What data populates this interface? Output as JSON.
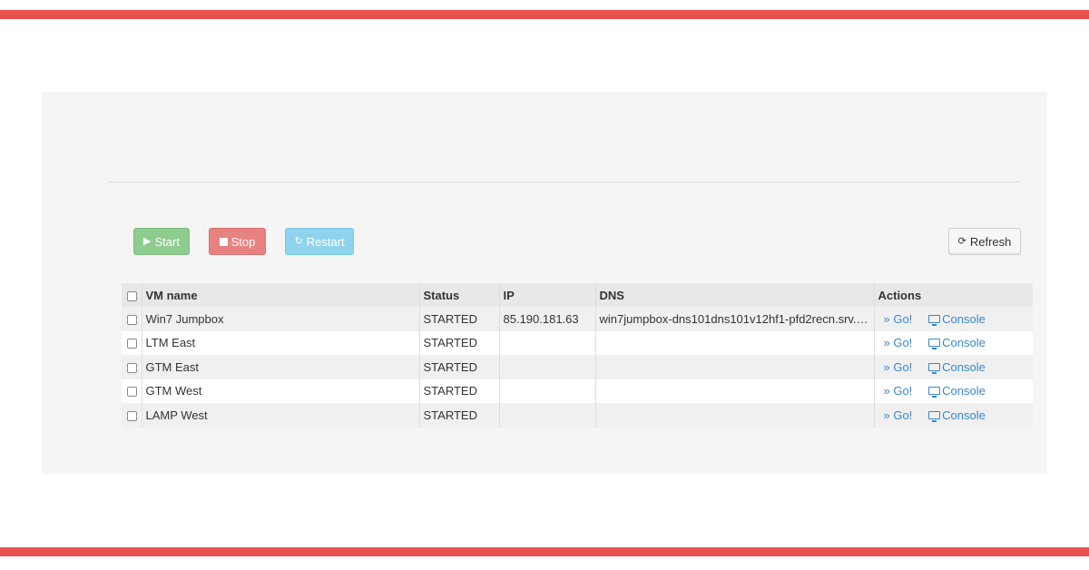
{
  "colors": {
    "stripe": "#e8514e",
    "start": "#8fcc8f",
    "stop": "#e68380",
    "restart": "#8fd3ee",
    "link": "#3a87c8"
  },
  "toolbar": {
    "start_label": "Start",
    "start_icon": "play-icon",
    "stop_label": "Stop",
    "stop_icon": "stop-icon",
    "restart_label": "Restart",
    "restart_icon": "restart-icon",
    "refresh_label": "Refresh",
    "refresh_icon": "refresh-icon"
  },
  "table": {
    "headers": {
      "name": "VM name",
      "status": "Status",
      "ip": "IP",
      "dns": "DNS",
      "actions": "Actions"
    },
    "rows": [
      {
        "name": "Win7 Jumpbox",
        "status": "STARTED",
        "ip": "85.190.181.63",
        "dns": "win7jumpbox-dns101dns101v12hf1-pfd2recn.srv.ra…",
        "go": "» Go!",
        "console": "Console"
      },
      {
        "name": "LTM East",
        "status": "STARTED",
        "ip": "",
        "dns": "",
        "go": "» Go!",
        "console": "Console"
      },
      {
        "name": "GTM East",
        "status": "STARTED",
        "ip": "",
        "dns": "",
        "go": "» Go!",
        "console": "Console"
      },
      {
        "name": "GTM West",
        "status": "STARTED",
        "ip": "",
        "dns": "",
        "go": "» Go!",
        "console": "Console"
      },
      {
        "name": "LAMP West",
        "status": "STARTED",
        "ip": "",
        "dns": "",
        "go": "» Go!",
        "console": "Console"
      }
    ]
  }
}
